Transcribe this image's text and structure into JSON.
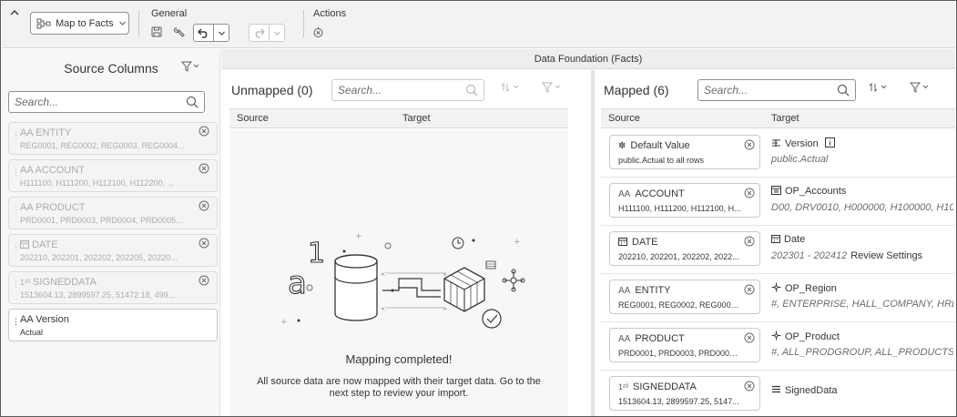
{
  "toolbar": {
    "collapse_icon": "chevron-up-icon",
    "map_button": {
      "label": "Map to Facts",
      "icon": "map-icon"
    },
    "groups": {
      "general": "General",
      "actions": "Actions"
    }
  },
  "source_columns": {
    "title": "Source Columns",
    "search_placeholder": "Search...",
    "items": [
      {
        "type": "AA",
        "name": "ENTITY",
        "values": "REG0001, REG0002, REG0003, REG0004...",
        "mapped": true
      },
      {
        "type": "AA",
        "name": "ACCOUNT",
        "values": "H111100, H111200, H112100, H112200, ...",
        "mapped": true
      },
      {
        "type": "AA",
        "name": "PRODUCT",
        "values": "PRD0001, PRD0003, PRD0004, PRD0005...",
        "mapped": true
      },
      {
        "type": "date",
        "name": "DATE",
        "values": "202210, 202201, 202202, 202205, 20220...",
        "mapped": true
      },
      {
        "type": "1²³",
        "name": "SIGNEDDATA",
        "values": "1513604.13, 2899597.25, 51472.18, 499...",
        "mapped": true
      },
      {
        "type": "AA",
        "name": "Version",
        "values": "Actual",
        "mapped": false
      }
    ]
  },
  "data_foundation": {
    "title": "Data Foundation (Facts)",
    "unmapped": {
      "title": "Unmapped (0)",
      "search_placeholder": "Search...",
      "col_source": "Source",
      "col_target": "Target",
      "empty_title": "Mapping completed!",
      "empty_text": "All source data are now mapped with their target data. Go to the next step to review your import."
    },
    "mapped": {
      "title": "Mapped (6)",
      "search_placeholder": "Search...",
      "col_source": "Source",
      "col_target": "Target",
      "rows": [
        {
          "src_type": "✽",
          "src_name": "Default Value",
          "src_values": "public.Actual to all rows",
          "tgt_icon": "version-icon",
          "tgt_name": "Version",
          "tgt_sub": "public.Actual",
          "tgt_extra": ""
        },
        {
          "src_type": "AA",
          "src_name": "ACCOUNT",
          "src_values": "H111100, H111200, H112100, H...",
          "tgt_icon": "account-icon",
          "tgt_name": "OP_Accounts",
          "tgt_sub": "D00, DRV0010, H000000, H100000, H10!",
          "tgt_extra": ""
        },
        {
          "src_type": "date",
          "src_name": "DATE",
          "src_values": "202210, 202201, 202202, 2022...",
          "tgt_icon": "calendar-icon",
          "tgt_name": "Date",
          "tgt_sub": "202301 - 202412",
          "tgt_extra": "Review Settings"
        },
        {
          "src_type": "AA",
          "src_name": "ENTITY",
          "src_values": "REG0001, REG0002, REG0003, ...",
          "tgt_icon": "hierarchy-icon",
          "tgt_name": "OP_Region",
          "tgt_sub": "#, ENTERPRISE, HALL_COMPANY, HREC",
          "tgt_extra": ""
        },
        {
          "src_type": "AA",
          "src_name": "PRODUCT",
          "src_values": "PRD0001, PRD0003, PRD0004, ...",
          "tgt_icon": "hierarchy-icon",
          "tgt_name": "OP_Product",
          "tgt_sub": "#, ALL_PRODGROUP, ALL_PRODUCTS,",
          "tgt_extra": ""
        },
        {
          "src_type": "1²³",
          "src_name": "SIGNEDDATA",
          "src_values": "1513604.13, 2899597.25, 5147...",
          "tgt_icon": "measure-icon",
          "tgt_name": "SignedData",
          "tgt_sub": "",
          "tgt_extra": ""
        }
      ]
    }
  }
}
